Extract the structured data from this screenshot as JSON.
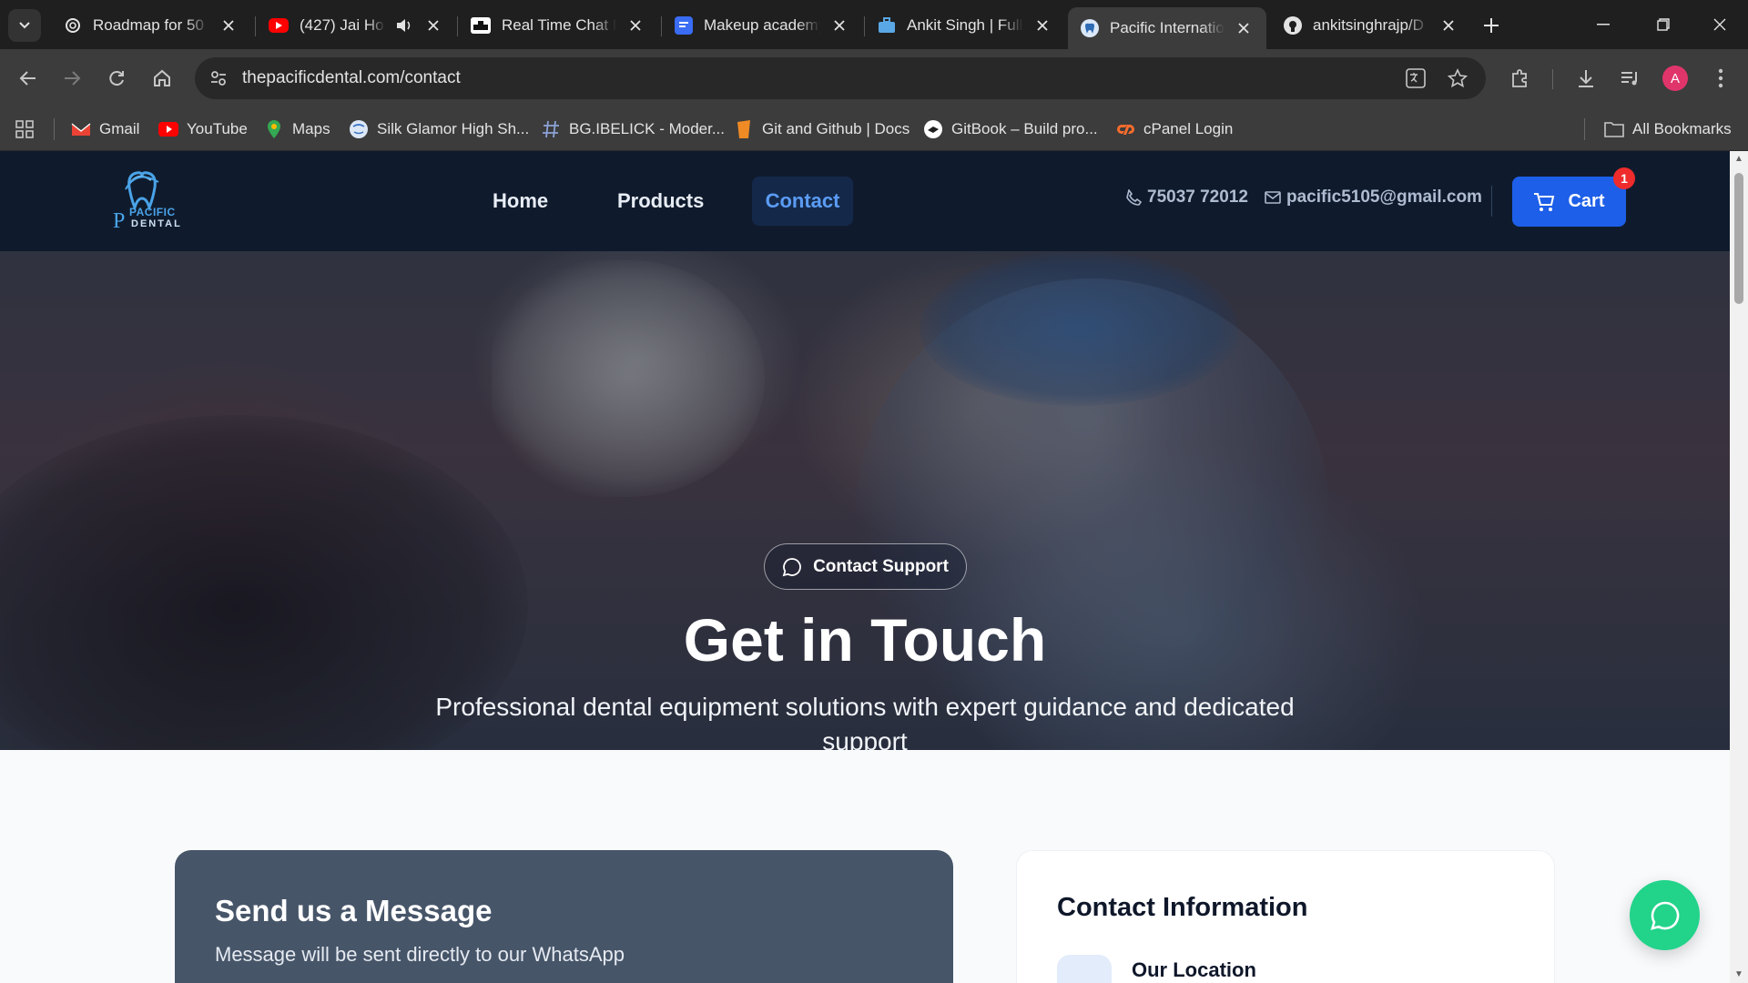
{
  "browser": {
    "tabs": [
      {
        "title": "Roadmap for 50 |",
        "icon": "openai-icon",
        "audio": false,
        "active": false
      },
      {
        "title": "(427) Jai Ho S",
        "icon": "youtube-icon",
        "audio": true,
        "active": false
      },
      {
        "title": "Real Time Chat Pl",
        "icon": "chat-app-icon",
        "audio": false,
        "active": false
      },
      {
        "title": "Makeup academy",
        "icon": "forms-icon",
        "audio": false,
        "active": false
      },
      {
        "title": "Ankit Singh | Full",
        "icon": "briefcase-icon",
        "audio": false,
        "active": false
      },
      {
        "title": "Pacific Internatio",
        "icon": "tooth-icon",
        "audio": false,
        "active": true
      },
      {
        "title": "ankitsinghrajp/D",
        "icon": "github-icon",
        "audio": false,
        "active": false
      }
    ],
    "url": "thepacificdental.com/contact",
    "profile_initial": "A",
    "bookmarks": [
      {
        "label": "Gmail",
        "icon": "gmail-icon"
      },
      {
        "label": "YouTube",
        "icon": "youtube-icon"
      },
      {
        "label": "Maps",
        "icon": "maps-icon"
      },
      {
        "label": "Silk Glamor High Sh...",
        "icon": "globe-icon"
      },
      {
        "label": "BG.IBELICK - Moder...",
        "icon": "hash-icon"
      },
      {
        "label": "Git and Github | Docs",
        "icon": "docs-icon"
      },
      {
        "label": "GitBook – Build pro...",
        "icon": "gitbook-icon"
      },
      {
        "label": "cPanel Login",
        "icon": "cpanel-icon"
      }
    ],
    "all_bookmarks_label": "All Bookmarks"
  },
  "site": {
    "logo_text_top": "PACIFIC",
    "logo_text_bottom": "DENTAL",
    "nav": {
      "home": "Home",
      "products": "Products",
      "contact": "Contact"
    },
    "phone": "75037 72012",
    "email": "pacific5105@gmail.com",
    "cart_label": "Cart",
    "cart_count": "1",
    "accent": "#1d5fe8",
    "nav_bg": "#0f1b2d"
  },
  "hero": {
    "badge": "Contact Support",
    "title": "Get in Touch",
    "subtitle": "Professional dental equipment solutions with expert guidance and dedicated support"
  },
  "form": {
    "title": "Send us a Message",
    "subtitle": "Message will be sent directly to our WhatsApp"
  },
  "info": {
    "title": "Contact Information",
    "location_label": "Our Location"
  }
}
